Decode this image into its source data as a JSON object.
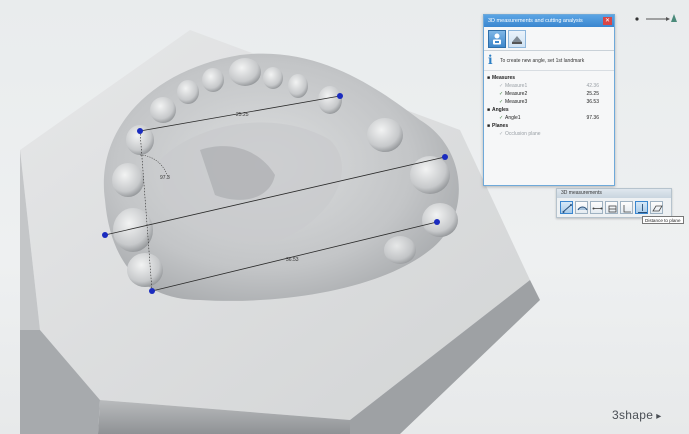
{
  "panel": {
    "title": "3D measurements and cutting analysis",
    "close": "✕",
    "hint": "To create new angle, set 1st landmark",
    "tree": {
      "measures_label": "Measures",
      "measures": [
        {
          "name": "Measure1",
          "value": "42.36",
          "enabled": false
        },
        {
          "name": "Measure2",
          "value": "25.25",
          "enabled": true
        },
        {
          "name": "Measure3",
          "value": "36.53",
          "enabled": true
        }
      ],
      "angles_label": "Angles",
      "angles": [
        {
          "name": "Angle1",
          "value": "97.36",
          "enabled": true
        }
      ],
      "planes_label": "Planes",
      "planes": [
        {
          "name": "Occlusion plane",
          "enabled": false
        }
      ]
    }
  },
  "toolbar": {
    "title": "3D measurements",
    "tooltip": "Distance to plane",
    "active_tool": "distance-to-plane"
  },
  "model": {
    "measure_top_label": "25.25",
    "measure_bottom_label": "36.53",
    "angle_label": "97.3"
  },
  "logo": {
    "text": "3shape"
  },
  "colors": {
    "accent": "#3a86cf",
    "landmark": "#1a2bbf",
    "model": "#bdbfc1"
  }
}
